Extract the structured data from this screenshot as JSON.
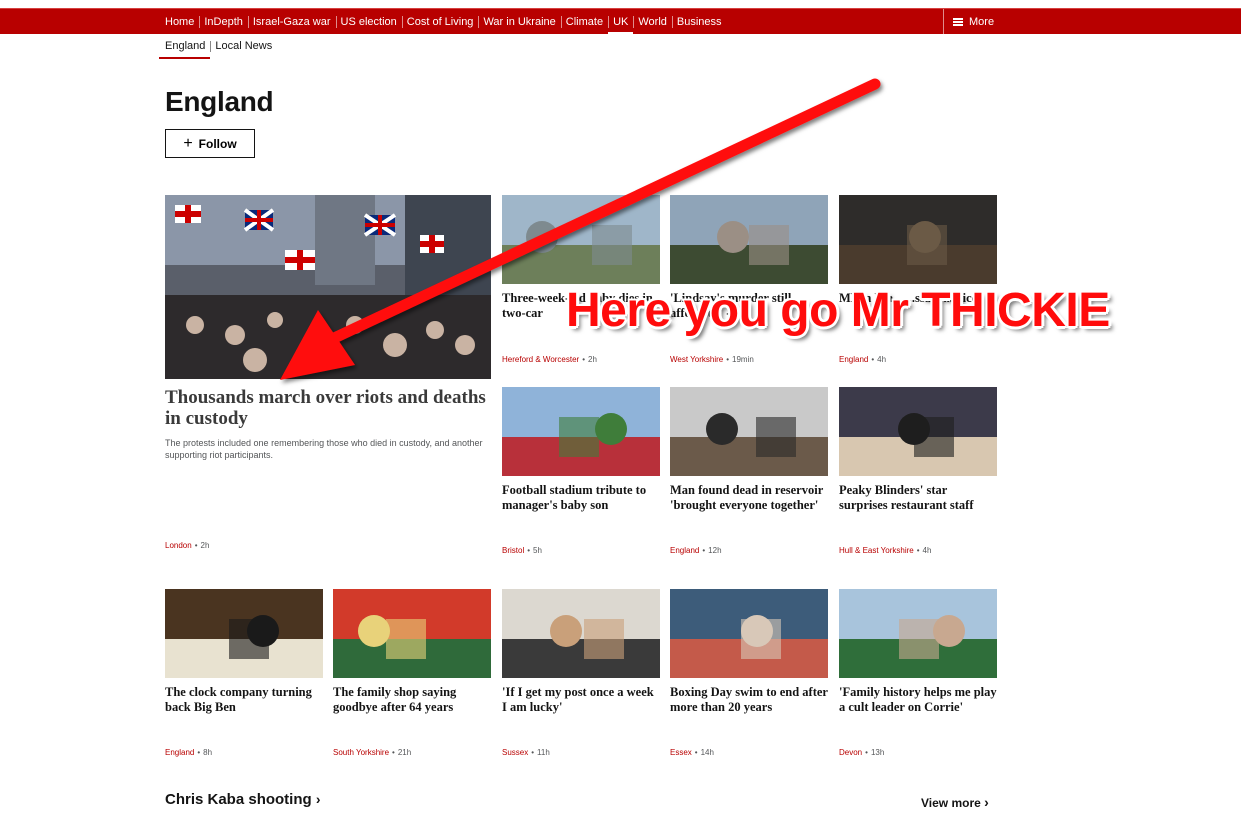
{
  "nav": {
    "items": [
      "Home",
      "InDepth",
      "Israel-Gaza war",
      "US election",
      "Cost of Living",
      "War in Ukraine",
      "Climate",
      "UK",
      "World",
      "Business"
    ],
    "active": "UK",
    "more": "More"
  },
  "subnav": {
    "items": [
      "England",
      "Local News"
    ]
  },
  "page": {
    "title": "England",
    "follow_label": "Follow"
  },
  "lead": {
    "headline": "Thousands march over riots and deaths in custody",
    "summary": "The protests included one remembering those who died in custody, and another supporting riot participants.",
    "tag": "London",
    "time": "2h"
  },
  "cards": [
    {
      "headline": "Three-week-old baby dies in two-car",
      "tag": "Hereford & Worcester",
      "time": "2h"
    },
    {
      "headline": "'Lindsay's murder still affects us' - a",
      "tag": "West Yorkshire",
      "time": "19min"
    },
    {
      "headline": "MP in hea... ...ssa... ...olice",
      "tag": "England",
      "time": "4h"
    },
    {
      "headline": "Football stadium tribute to manager's baby son",
      "tag": "Bristol",
      "time": "5h"
    },
    {
      "headline": "Man found dead in reservoir 'brought everyone together'",
      "tag": "England",
      "time": "12h"
    },
    {
      "headline": "Peaky Blinders' star surprises restaurant staff",
      "tag": "Hull & East Yorkshire",
      "time": "4h"
    },
    {
      "headline": "The clock company turning back Big Ben",
      "tag": "England",
      "time": "8h"
    },
    {
      "headline": "The family shop saying goodbye after 64 years",
      "tag": "South Yorkshire",
      "time": "21h"
    },
    {
      "headline": "'If I get my post once a week I am lucky'",
      "tag": "Sussex",
      "time": "11h"
    },
    {
      "headline": "Boxing Day swim to end after more than 20 years",
      "tag": "Essex",
      "time": "14h"
    },
    {
      "headline": "'Family history helps me play a cult leader on Corrie'",
      "tag": "Devon",
      "time": "13h"
    }
  ],
  "section": {
    "title": "Chris Kaba shooting",
    "view_more": "View more"
  },
  "annotation": {
    "caption": "Here you go Mr THICKIE",
    "color": "#ff0c0c"
  },
  "colors": {
    "brand": "#b80000",
    "tag": "#b80000"
  }
}
